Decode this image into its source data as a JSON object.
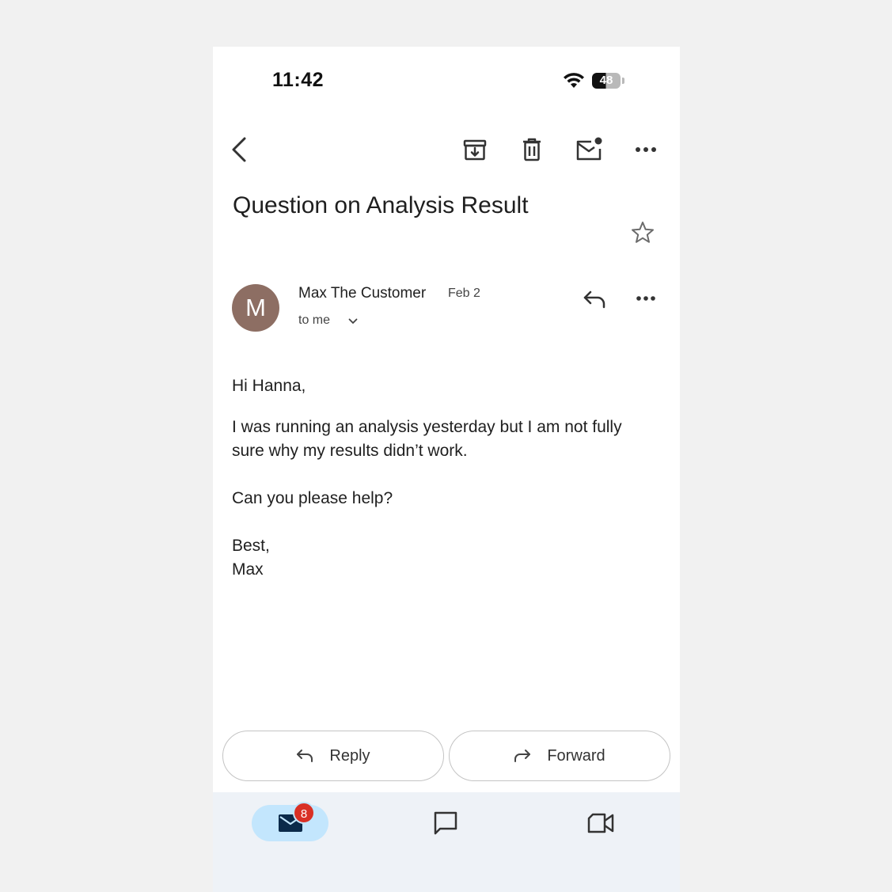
{
  "status": {
    "time": "11:42",
    "battery": "48"
  },
  "toolbar": {
    "back_icon": "arrow-back-icon",
    "archive_icon": "archive-icon",
    "delete_icon": "trash-icon",
    "mark_unread_icon": "mail-unread-icon",
    "more_icon": "more-horiz-icon"
  },
  "email": {
    "subject": "Question on Analysis Result",
    "sender_initial": "M",
    "sender_name": "Max The Customer",
    "date": "Feb 2",
    "recipient": "to me",
    "body": {
      "greeting": "Hi Hanna,",
      "line1": "I was running an analysis yesterday but I am not fully sure why my results didn’t work.",
      "line2": "Can you please help?",
      "signoff": "Best,",
      "signature": "Max"
    }
  },
  "actions": {
    "reply_label": "Reply",
    "forward_label": "Forward"
  },
  "bottom_nav": {
    "mail_badge": "8",
    "items": [
      "mail-icon",
      "chat-icon",
      "meet-icon"
    ]
  },
  "colors": {
    "avatar": "#8d6e63",
    "badge": "#d93025",
    "nav_active": "#c3e6fd",
    "nav_bg": "#eef2f7"
  }
}
